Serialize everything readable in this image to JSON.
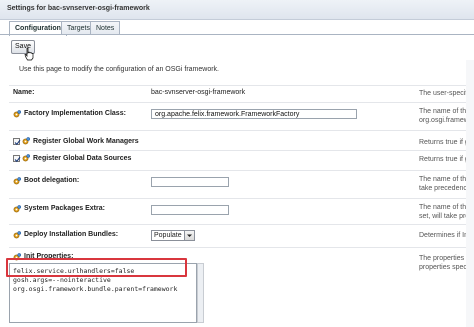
{
  "window": {
    "title": "Settings for bac-svnserver-osgi-framework"
  },
  "tabs": [
    {
      "label": "Configuration"
    },
    {
      "label": "Targets"
    },
    {
      "label": "Notes"
    }
  ],
  "toolbar": {
    "save_label": "Save"
  },
  "intro_text": "Use this page to modify the configuration of an OSGi framework.",
  "rows": {
    "name": {
      "label": "Name:",
      "value": "bac-svnserver-osgi-framework",
      "note": "The user-specifi"
    },
    "factory": {
      "label": "Factory Implementation Class:",
      "value": "org.apache.felix.framework.FrameworkFactory",
      "note1": "The name of the",
      "note2": "org.osgi.framewo"
    },
    "work_managers": {
      "label": "Register Global Work Managers",
      "note": "Returns true if globa",
      "checked": true
    },
    "data_sources": {
      "label": "Register Global Data Sources",
      "note": "Returns true if globa",
      "checked": true
    },
    "boot_delegation": {
      "label": "Boot delegation:",
      "value": "",
      "note1": "The name of the",
      "note2": "take precedence ov"
    },
    "system_packages": {
      "label": "System Packages Extra:",
      "value": "",
      "note1": "The name of the",
      "note2": "set, will take prece"
    },
    "deploy_bundles": {
      "label": "Deploy Installation Bundles:",
      "selected": "Populate",
      "note": "Determines if Instal"
    },
    "init_properties": {
      "label": "Init Properties:",
      "lines": [
        "felix.service.urlhandlers=false",
        "gosh.args=--nointeractive",
        "org.osgi.framework.bundle.parent=framework"
      ],
      "note1": "The properties to be",
      "note2": "properties specific to"
    }
  },
  "colors": {
    "highlight": "#d9363e",
    "tab_border": "#aab4c2"
  }
}
